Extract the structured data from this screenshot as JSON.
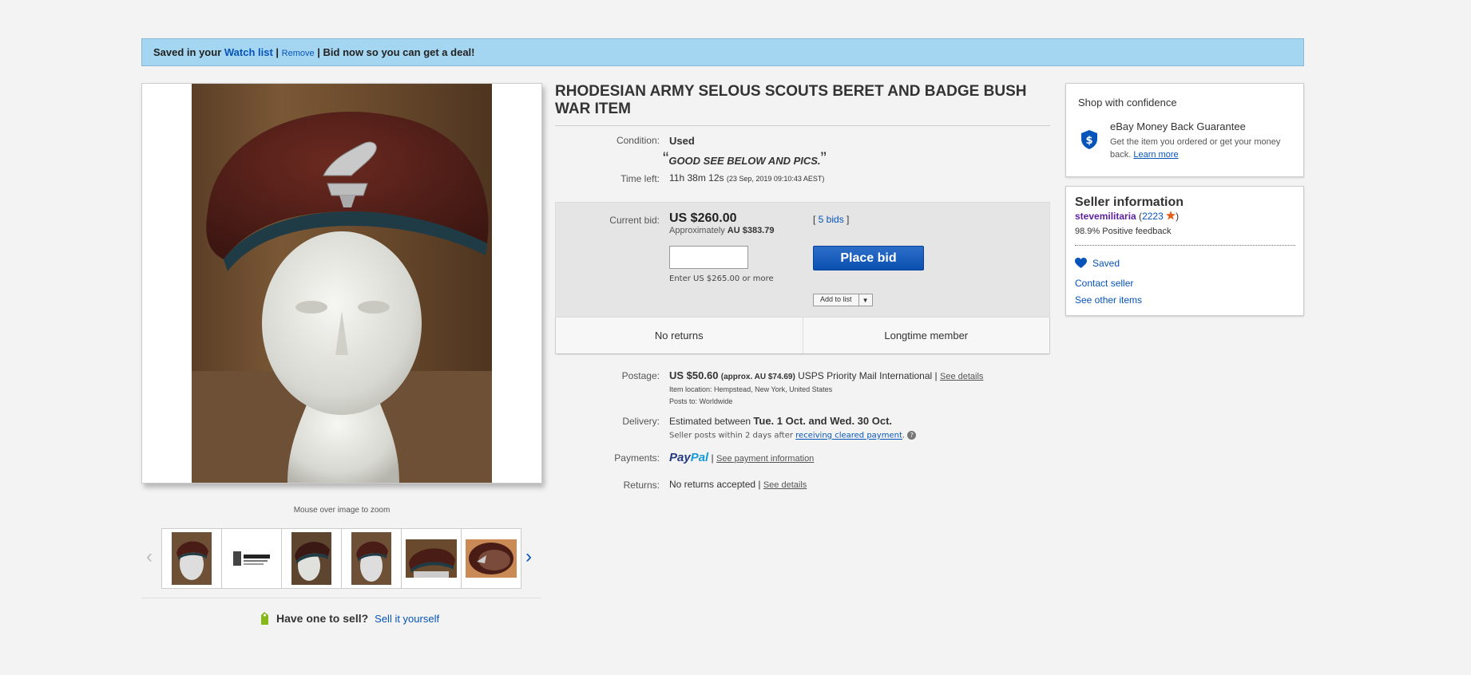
{
  "banner": {
    "prefix": "Saved in your ",
    "watch_link": "Watch list",
    "sep1": " | ",
    "remove": "Remove",
    "sep2": " | ",
    "suffix": "Bid now so you can get a deal!"
  },
  "gallery": {
    "zoom_hint": "Mouse over image to zoom",
    "prev_arrow": "‹",
    "next_arrow": "›",
    "thumb_count": 6
  },
  "sell": {
    "question": "Have one to sell?",
    "link": "Sell it yourself"
  },
  "item": {
    "title": "RHODESIAN ARMY SELOUS SCOUTS BERET AND BADGE BUSH WAR ITEM",
    "condition_label": "Condition:",
    "condition_value": "Used",
    "condition_note": "GOOD SEE BELOW AND PICS.",
    "time_left_label": "Time left:",
    "time_left_value": "11h 38m 12s",
    "time_left_end": "(23 Sep, 2019  09:10:43 AEST)"
  },
  "bid": {
    "current_bid_label": "Current bid:",
    "current_bid": "US $260.00",
    "approx_prefix": "Approximately ",
    "approx_value": "AU $383.79",
    "bids_open": "[ ",
    "bids_link": "5 bids",
    "bids_close": " ]",
    "input_value": "",
    "enter_hint": "Enter US $265.00 or more",
    "place_bid": "Place bid",
    "add_to_list": "Add to list",
    "returns_badge": "No returns",
    "member_badge": "Longtime member"
  },
  "shipping": {
    "postage_label": "Postage:",
    "postage_price": "US $50.60",
    "postage_approx": "(approx. AU $74.69)",
    "postage_service": "USPS Priority Mail International | ",
    "postage_details": "See details",
    "location_label": "Item location:",
    "location_value": "Hempstead, New York, United States",
    "posts_to_label": "Posts to:",
    "posts_to_value": "Worldwide",
    "delivery_label": "Delivery:",
    "delivery_prefix": "Estimated between ",
    "delivery_dates": "Tue. 1 Oct. and Wed. 30 Oct.",
    "seller_posts": "Seller posts within 2 days after ",
    "cleared_payment": "receiving cleared payment",
    "seller_posts_end": ".",
    "help_icon": "?",
    "payments_label": "Payments:",
    "paypal_1": "Pay",
    "paypal_2": "Pal",
    "payment_sep": " | ",
    "payment_link": "See payment information",
    "returns_label": "Returns:",
    "returns_value": "No returns accepted | ",
    "returns_link": "See details"
  },
  "confidence": {
    "title": "Shop with confidence",
    "guarantee_title": "eBay Money Back Guarantee",
    "guarantee_text": "Get the item you ordered or get your money back. ",
    "learn_more": "Learn more"
  },
  "seller": {
    "title": "Seller information",
    "name": "stevemilitaria",
    "score_open": " (",
    "score": "2223",
    "score_close": ")",
    "feedback": "98.9% Positive feedback",
    "saved": "Saved",
    "contact": "Contact seller",
    "other_items": "See other items"
  },
  "colors": {
    "link": "#0654ba",
    "banner_bg": "#a5d6f1",
    "bid_button": "#0b51b0",
    "seller_name": "#5d1f9e",
    "star": "#e55b13"
  }
}
